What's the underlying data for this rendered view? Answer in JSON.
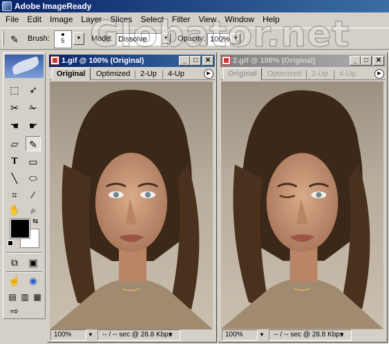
{
  "app": {
    "title": "Adobe ImageReady"
  },
  "menu": [
    "File",
    "Edit",
    "Image",
    "Layer",
    "Slices",
    "Select",
    "Filter",
    "View",
    "Window",
    "Help"
  ],
  "options": {
    "brush_label": "Brush:",
    "brush_size": "5",
    "mode_label": "Mode:",
    "mode_value": "Dissolve",
    "opacity_label": "Opacity:",
    "opacity_value": "100%"
  },
  "watermark": "Globator.net",
  "windows": [
    {
      "title": "1.gif @ 100% (Original)",
      "tabs": [
        "Original",
        "Optimized",
        "2-Up",
        "4-Up"
      ],
      "zoom": "100%",
      "speed": "-- / -- sec @ 28.8 Kbps",
      "eyes": "open"
    },
    {
      "title": "2.gif @ 100% (Original)",
      "tabs": [
        "Original",
        "Optimized",
        "2-Up",
        "4-Up"
      ],
      "zoom": "100%",
      "speed": "-- / -- sec @ 28.8 Kbps",
      "eyes": "one-closed"
    }
  ],
  "colors": {
    "foreground": "#000000",
    "background": "#ffffff",
    "title_active": "#0a246a"
  },
  "toolbox": {
    "icons": [
      "marquee-icon",
      "move-icon",
      "slice-icon",
      "slice-select-icon",
      "hand-map-icon",
      "pointer-map-icon",
      "eraser-icon",
      "paintbrush-icon",
      "type-icon",
      "rectangle-icon",
      "line-icon",
      "ellipse-icon",
      "crop-icon",
      "eyedropper-icon",
      "hand-icon",
      "zoom-icon"
    ]
  }
}
